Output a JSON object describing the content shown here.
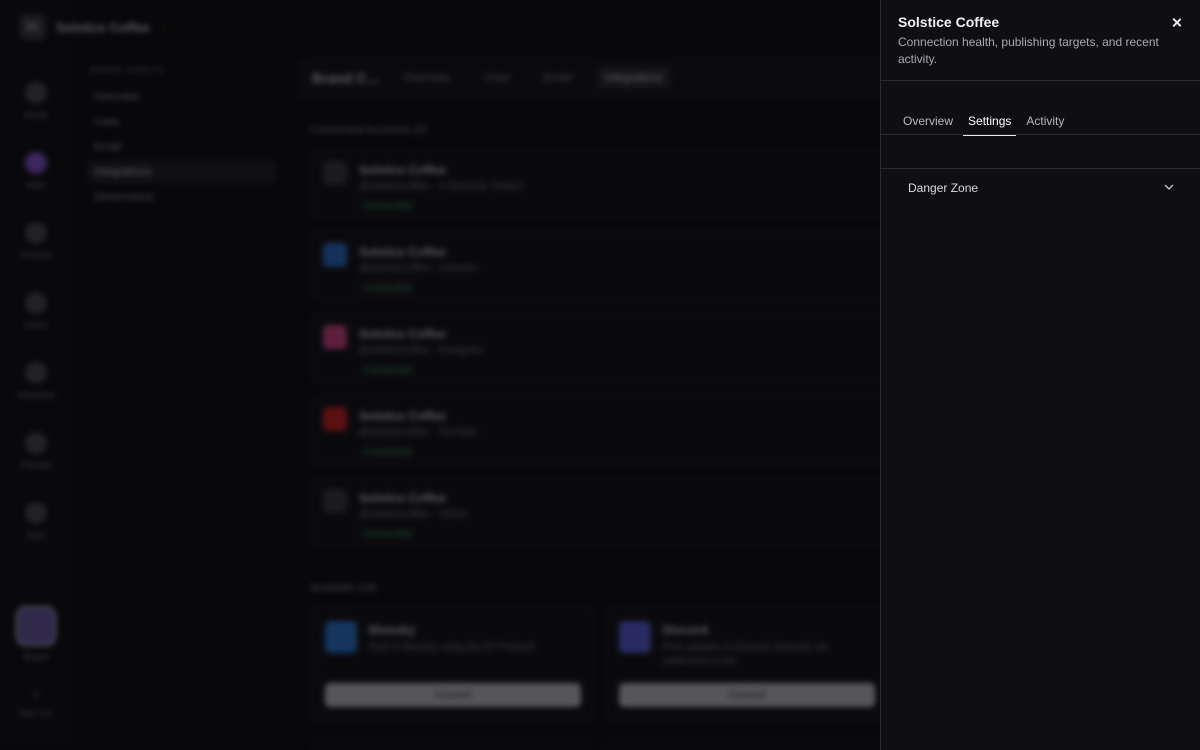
{
  "background": {
    "workspace": {
      "avatar": "SC",
      "name": "Solstice Coffee"
    },
    "rail": [
      {
        "label": "Home"
      },
      {
        "label": "Mark"
      },
      {
        "label": "Content"
      },
      {
        "label": "Users"
      },
      {
        "label": "Advertise"
      },
      {
        "label": "Presets"
      },
      {
        "label": "Apps"
      },
      {
        "label": "Brand"
      },
      {
        "label": "New Co."
      }
    ],
    "subnav": {
      "title": "BRAND ASSETS",
      "items": [
        "Overview",
        "Case",
        "Email",
        "Integrations",
        "Governance"
      ]
    },
    "topbar": {
      "brand": "Brand C...",
      "tabs": [
        "Overview",
        "Crew",
        "Email",
        "Integrations"
      ]
    },
    "connected_title": "Connected Accounts (5)",
    "accounts": [
      {
        "name": "Solstice Coffee",
        "sub": "@solsticecoffee · X (formerly Twitter)",
        "status": "Connected",
        "color": "#3a3a44"
      },
      {
        "name": "Solstice Coffee",
        "sub": "@solsticecoffee · LinkedIn",
        "status": "Connected",
        "color": "#2d6fd6"
      },
      {
        "name": "Solstice Coffee",
        "sub": "@solsticecoffee · Instagram",
        "status": "Connected",
        "color": "#d9468f"
      },
      {
        "name": "Solstice Coffee",
        "sub": "@solsticecoffee · YouTube",
        "status": "Connected",
        "color": "#d52020"
      },
      {
        "name": "Solstice Coffee",
        "sub": "@solsticecoffee · TikTok",
        "status": "Connected",
        "color": "#3a3a44"
      }
    ],
    "available_title": "Available (18)",
    "available": [
      {
        "name": "Bluesky",
        "sub": "Post to Bluesky using the AT Protocol",
        "button": "Connect",
        "color": "#2f7de1"
      },
      {
        "name": "Discord",
        "sub": "Post updates to Discord channels via webhooks or bot",
        "button": "Connect",
        "color": "#5b63e6"
      }
    ]
  },
  "panel": {
    "title": "Solstice Coffee",
    "description": "Connection health, publishing targets, and recent activity.",
    "tabs": [
      "Overview",
      "Settings",
      "Activity"
    ],
    "active_tab": "Settings",
    "accordion": {
      "label": "Danger Zone"
    }
  }
}
